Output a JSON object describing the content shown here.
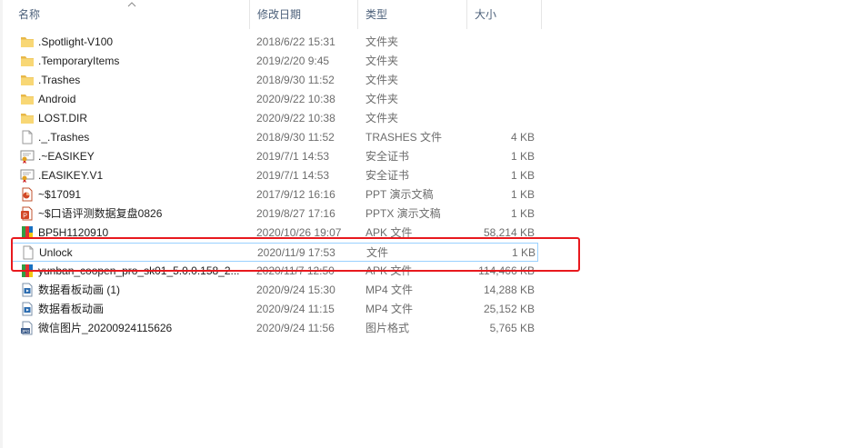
{
  "columns": {
    "name": "名称",
    "date": "修改日期",
    "type": "类型",
    "size": "大小"
  },
  "files": [
    {
      "name": ".Spotlight-V100",
      "date": "2018/6/22 15:31",
      "type": "文件夹",
      "size": "",
      "icon": "folder-icon"
    },
    {
      "name": ".TemporaryItems",
      "date": "2019/2/20 9:45",
      "type": "文件夹",
      "size": "",
      "icon": "folder-icon"
    },
    {
      "name": ".Trashes",
      "date": "2018/9/30 11:52",
      "type": "文件夹",
      "size": "",
      "icon": "folder-icon"
    },
    {
      "name": "Android",
      "date": "2020/9/22 10:38",
      "type": "文件夹",
      "size": "",
      "icon": "folder-icon"
    },
    {
      "name": "LOST.DIR",
      "date": "2020/9/22 10:38",
      "type": "文件夹",
      "size": "",
      "icon": "folder-icon"
    },
    {
      "name": "._.Trashes",
      "date": "2018/9/30 11:52",
      "type": "TRASHES 文件",
      "size": "4 KB",
      "icon": "file-icon"
    },
    {
      "name": ".~EASIKEY",
      "date": "2019/7/1 14:53",
      "type": "安全证书",
      "size": "1 KB",
      "icon": "certificate-icon"
    },
    {
      "name": ".EASIKEY.V1",
      "date": "2019/7/1 14:53",
      "type": "安全证书",
      "size": "1 KB",
      "icon": "certificate-icon"
    },
    {
      "name": "~$17091",
      "date": "2017/9/12 16:16",
      "type": "PPT 演示文稿",
      "size": "1 KB",
      "icon": "ppt-icon"
    },
    {
      "name": "~$口语评测数据复盘0826",
      "date": "2019/8/27 17:16",
      "type": "PPTX 演示文稿",
      "size": "1 KB",
      "icon": "pptx-icon"
    },
    {
      "name": "BP5H1120910",
      "date": "2020/10/26 19:07",
      "type": "APK 文件",
      "size": "58,214 KB",
      "icon": "apk-icon"
    },
    {
      "name": "Unlock",
      "date": "2020/11/9 17:53",
      "type": "文件",
      "size": "1 KB",
      "icon": "file-icon"
    },
    {
      "name": "yunban_coopen_pro_sk01_5.0.0.158_2...",
      "date": "2020/11/7 12:50",
      "type": "APK 文件",
      "size": "114,466 KB",
      "icon": "apk-icon"
    },
    {
      "name": "数据看板动画 (1)",
      "date": "2020/9/24 15:30",
      "type": "MP4 文件",
      "size": "14,288 KB",
      "icon": "video-icon"
    },
    {
      "name": "数据看板动画",
      "date": "2020/9/24 11:15",
      "type": "MP4 文件",
      "size": "25,152 KB",
      "icon": "video-icon"
    },
    {
      "name": "微信图片_20200924115626",
      "date": "2020/9/24 11:56",
      "type": "图片格式",
      "size": "5,765 KB",
      "icon": "image-icon"
    }
  ],
  "selected_index": 11,
  "colors": {
    "header_text": "#4c607a",
    "folder": "#f8d775",
    "selection_border": "#99d1ff",
    "highlight_box": "#e8191e"
  }
}
